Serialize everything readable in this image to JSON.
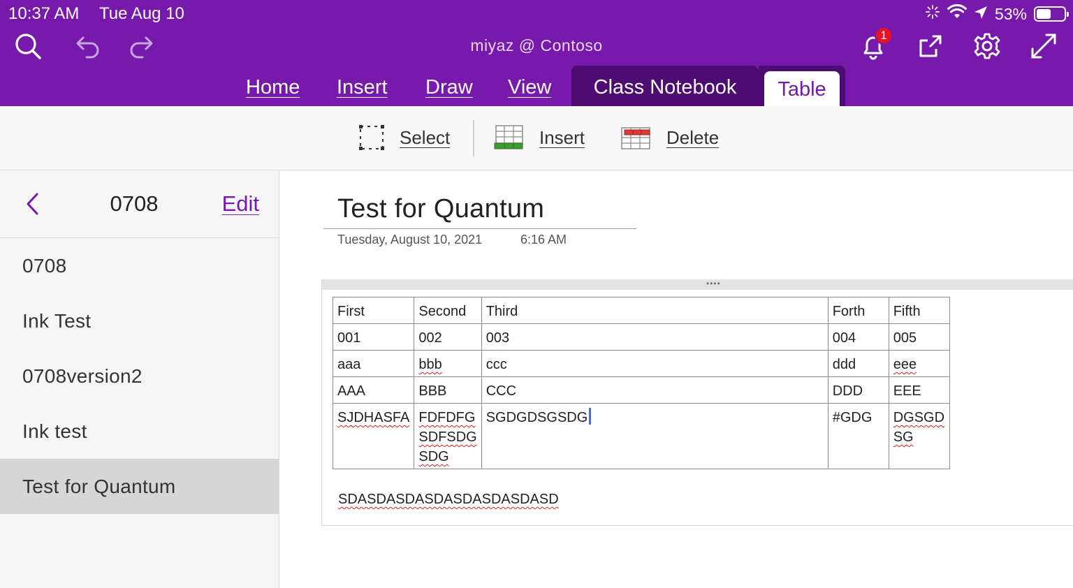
{
  "status_bar": {
    "time": "10:37 AM",
    "date": "Tue Aug 10",
    "battery": "53%",
    "battery_level": 0.53
  },
  "header": {
    "title": "miyaz @ Contoso",
    "notification_count": "1",
    "icons": [
      "search-icon",
      "undo-icon",
      "redo-icon",
      "bell-icon",
      "share-icon",
      "gear-icon",
      "expand-icon"
    ]
  },
  "tabs": {
    "home": "Home",
    "insert": "Insert",
    "draw": "Draw",
    "view": "View",
    "class_notebook": "Class Notebook",
    "table": "Table",
    "active": "Table"
  },
  "ribbon": {
    "select": "Select",
    "insert": "Insert",
    "delete": "Delete"
  },
  "sidebar": {
    "title": "0708",
    "edit": "Edit",
    "pages": [
      {
        "label": "0708"
      },
      {
        "label": "Ink Test"
      },
      {
        "label": "0708version2"
      },
      {
        "label": "Ink test"
      },
      {
        "label": "Test for Quantum",
        "selected": true
      }
    ]
  },
  "note": {
    "title": "Test for Quantum",
    "date": "Tuesday, August 10, 2021",
    "time": "6:16 AM",
    "table": {
      "headers": [
        "First",
        "Second",
        "Third",
        "Forth",
        "Fifth"
      ],
      "rows": [
        [
          "001",
          "002",
          "003",
          "004",
          "005"
        ],
        [
          "aaa",
          "bbb",
          "ccc",
          "ddd",
          "eee"
        ],
        [
          "AAA",
          "BBB",
          "CCC",
          "DDD",
          "EEE"
        ],
        [
          "SJDHASFA",
          "FDFDFG SDFSDG SDG",
          "SGDGDSGSDG",
          "#GDG",
          "DGSGD SG"
        ]
      ],
      "last_row_lines": {
        "second": [
          "FDFDFG",
          "SDFSDG",
          "SDG"
        ],
        "fifth": [
          "DGSGD",
          "SG"
        ]
      }
    },
    "trailing_text": "SDASDASDASDASDASDASDASD"
  },
  "colors": {
    "brand": "#7719aa",
    "brand_dark": "#4e0c72",
    "selected_page": "#d6d6d6",
    "spellcheck": "#e0221e",
    "cursor": "#3b6ee6"
  }
}
